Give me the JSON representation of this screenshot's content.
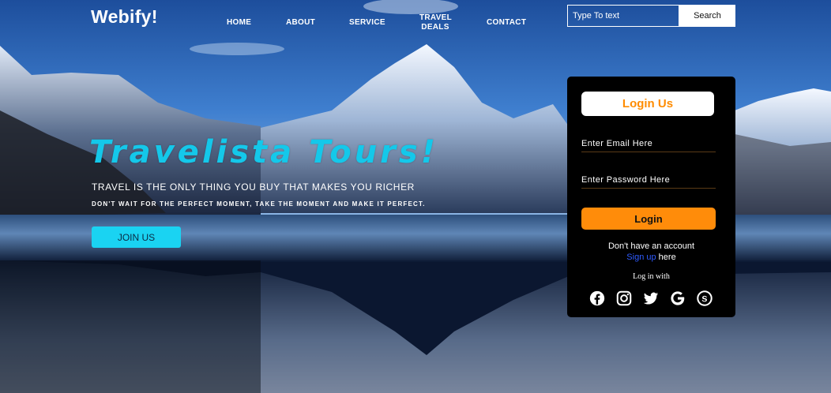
{
  "brand": {
    "logo": "Webify!"
  },
  "nav": {
    "items": [
      "HOME",
      "ABOUT",
      "SERVICE",
      "TRAVEL DEALS",
      "CONTACT"
    ],
    "travel_deals_line1": "TRAVEL",
    "travel_deals_line2": "DEALS"
  },
  "search": {
    "placeholder": "Type To text",
    "button_label": "Search"
  },
  "hero": {
    "title": "Travelista Tours!",
    "subtitle": "TRAVEL IS THE ONLY THING YOU BUY THAT MAKES YOU RICHER",
    "tagline": "DON'T WAIT FOR THE PERFECT MOMENT, TAKE THE MOMENT AND MAKE IT PERFECT.",
    "cta_label": "JOIN US"
  },
  "login": {
    "heading": "Login Us",
    "email_placeholder": "Enter Email Here",
    "password_placeholder": "Enter Password Here",
    "button_label": "Login",
    "no_account_text": "Don't have an account",
    "signup_link": "Sign up",
    "signup_suffix": " here",
    "login_with": "Log in with",
    "social_icons": [
      "facebook-icon",
      "instagram-icon",
      "twitter-icon",
      "google-icon",
      "skype-icon"
    ]
  },
  "colors": {
    "accent_orange": "#ff8c0a",
    "hero_cyan": "#14c8ea",
    "join_button": "#1ad3f2",
    "signup_blue": "#2f5bff",
    "panel_bg": "#000000"
  }
}
